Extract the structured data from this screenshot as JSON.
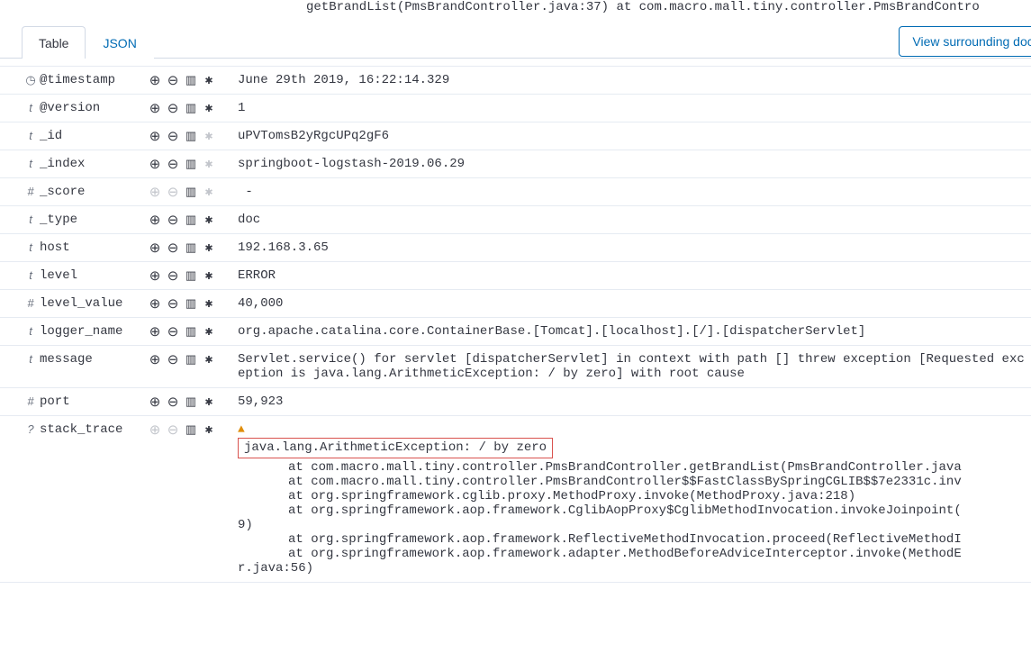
{
  "top_truncated": "getBrandList(PmsBrandController.java:37) at com.macro.mall.tiny.controller.PmsBrandContro",
  "tabs": {
    "table": "Table",
    "json": "JSON"
  },
  "view_button": "View surrounding docume",
  "fields": [
    {
      "type": "clock",
      "name": "@timestamp",
      "value": "June 29th 2019, 16:22:14.329",
      "star_dim": false,
      "mag_dim": false
    },
    {
      "type": "t",
      "name": "@version",
      "value": "1",
      "star_dim": false,
      "mag_dim": false
    },
    {
      "type": "t",
      "name": "_id",
      "value": "uPVTomsB2yRgcUPq2gF6",
      "star_dim": true,
      "mag_dim": false
    },
    {
      "type": "t",
      "name": "_index",
      "value": "springboot-logstash-2019.06.29",
      "star_dim": true,
      "mag_dim": false
    },
    {
      "type": "#",
      "name": "_score",
      "value": " -",
      "star_dim": true,
      "mag_dim": true
    },
    {
      "type": "t",
      "name": "_type",
      "value": "doc",
      "star_dim": false,
      "mag_dim": false
    },
    {
      "type": "t",
      "name": "host",
      "value": "192.168.3.65",
      "star_dim": false,
      "mag_dim": false
    },
    {
      "type": "t",
      "name": "level",
      "value": "ERROR",
      "star_dim": false,
      "mag_dim": false
    },
    {
      "type": "#",
      "name": "level_value",
      "value": "40,000",
      "star_dim": false,
      "mag_dim": false
    },
    {
      "type": "t",
      "name": "logger_name",
      "value": "org.apache.catalina.core.ContainerBase.[Tomcat].[localhost].[/].[dispatcherServlet]",
      "star_dim": false,
      "mag_dim": false
    },
    {
      "type": "t",
      "name": "message",
      "value": "Servlet.service() for servlet [dispatcherServlet] in context with path [] threw exception [Requested exception is java.lang.ArithmeticException: / by zero] with root cause",
      "star_dim": false,
      "mag_dim": false
    },
    {
      "type": "#",
      "name": "port",
      "value": "59,923",
      "star_dim": false,
      "mag_dim": false
    }
  ],
  "stack_trace": {
    "type": "?",
    "name": "stack_trace",
    "highlight": "java.lang.ArithmeticException: / by zero",
    "lines_indent": [
      "at com.macro.mall.tiny.controller.PmsBrandController.getBrandList(PmsBrandController.java",
      "at com.macro.mall.tiny.controller.PmsBrandController$$FastClassBySpringCGLIB$$7e2331c.inv",
      "at org.springframework.cglib.proxy.MethodProxy.invoke(MethodProxy.java:218)",
      "at org.springframework.aop.framework.CglibAopProxy$CglibMethodInvocation.invokeJoinpoint("
    ],
    "cont1": "9)",
    "lines_indent2": [
      "at org.springframework.aop.framework.ReflectiveMethodInvocation.proceed(ReflectiveMethodI",
      "at org.springframework.aop.framework.adapter.MethodBeforeAdviceInterceptor.invoke(MethodE"
    ],
    "cont2": "r.java:56)"
  }
}
